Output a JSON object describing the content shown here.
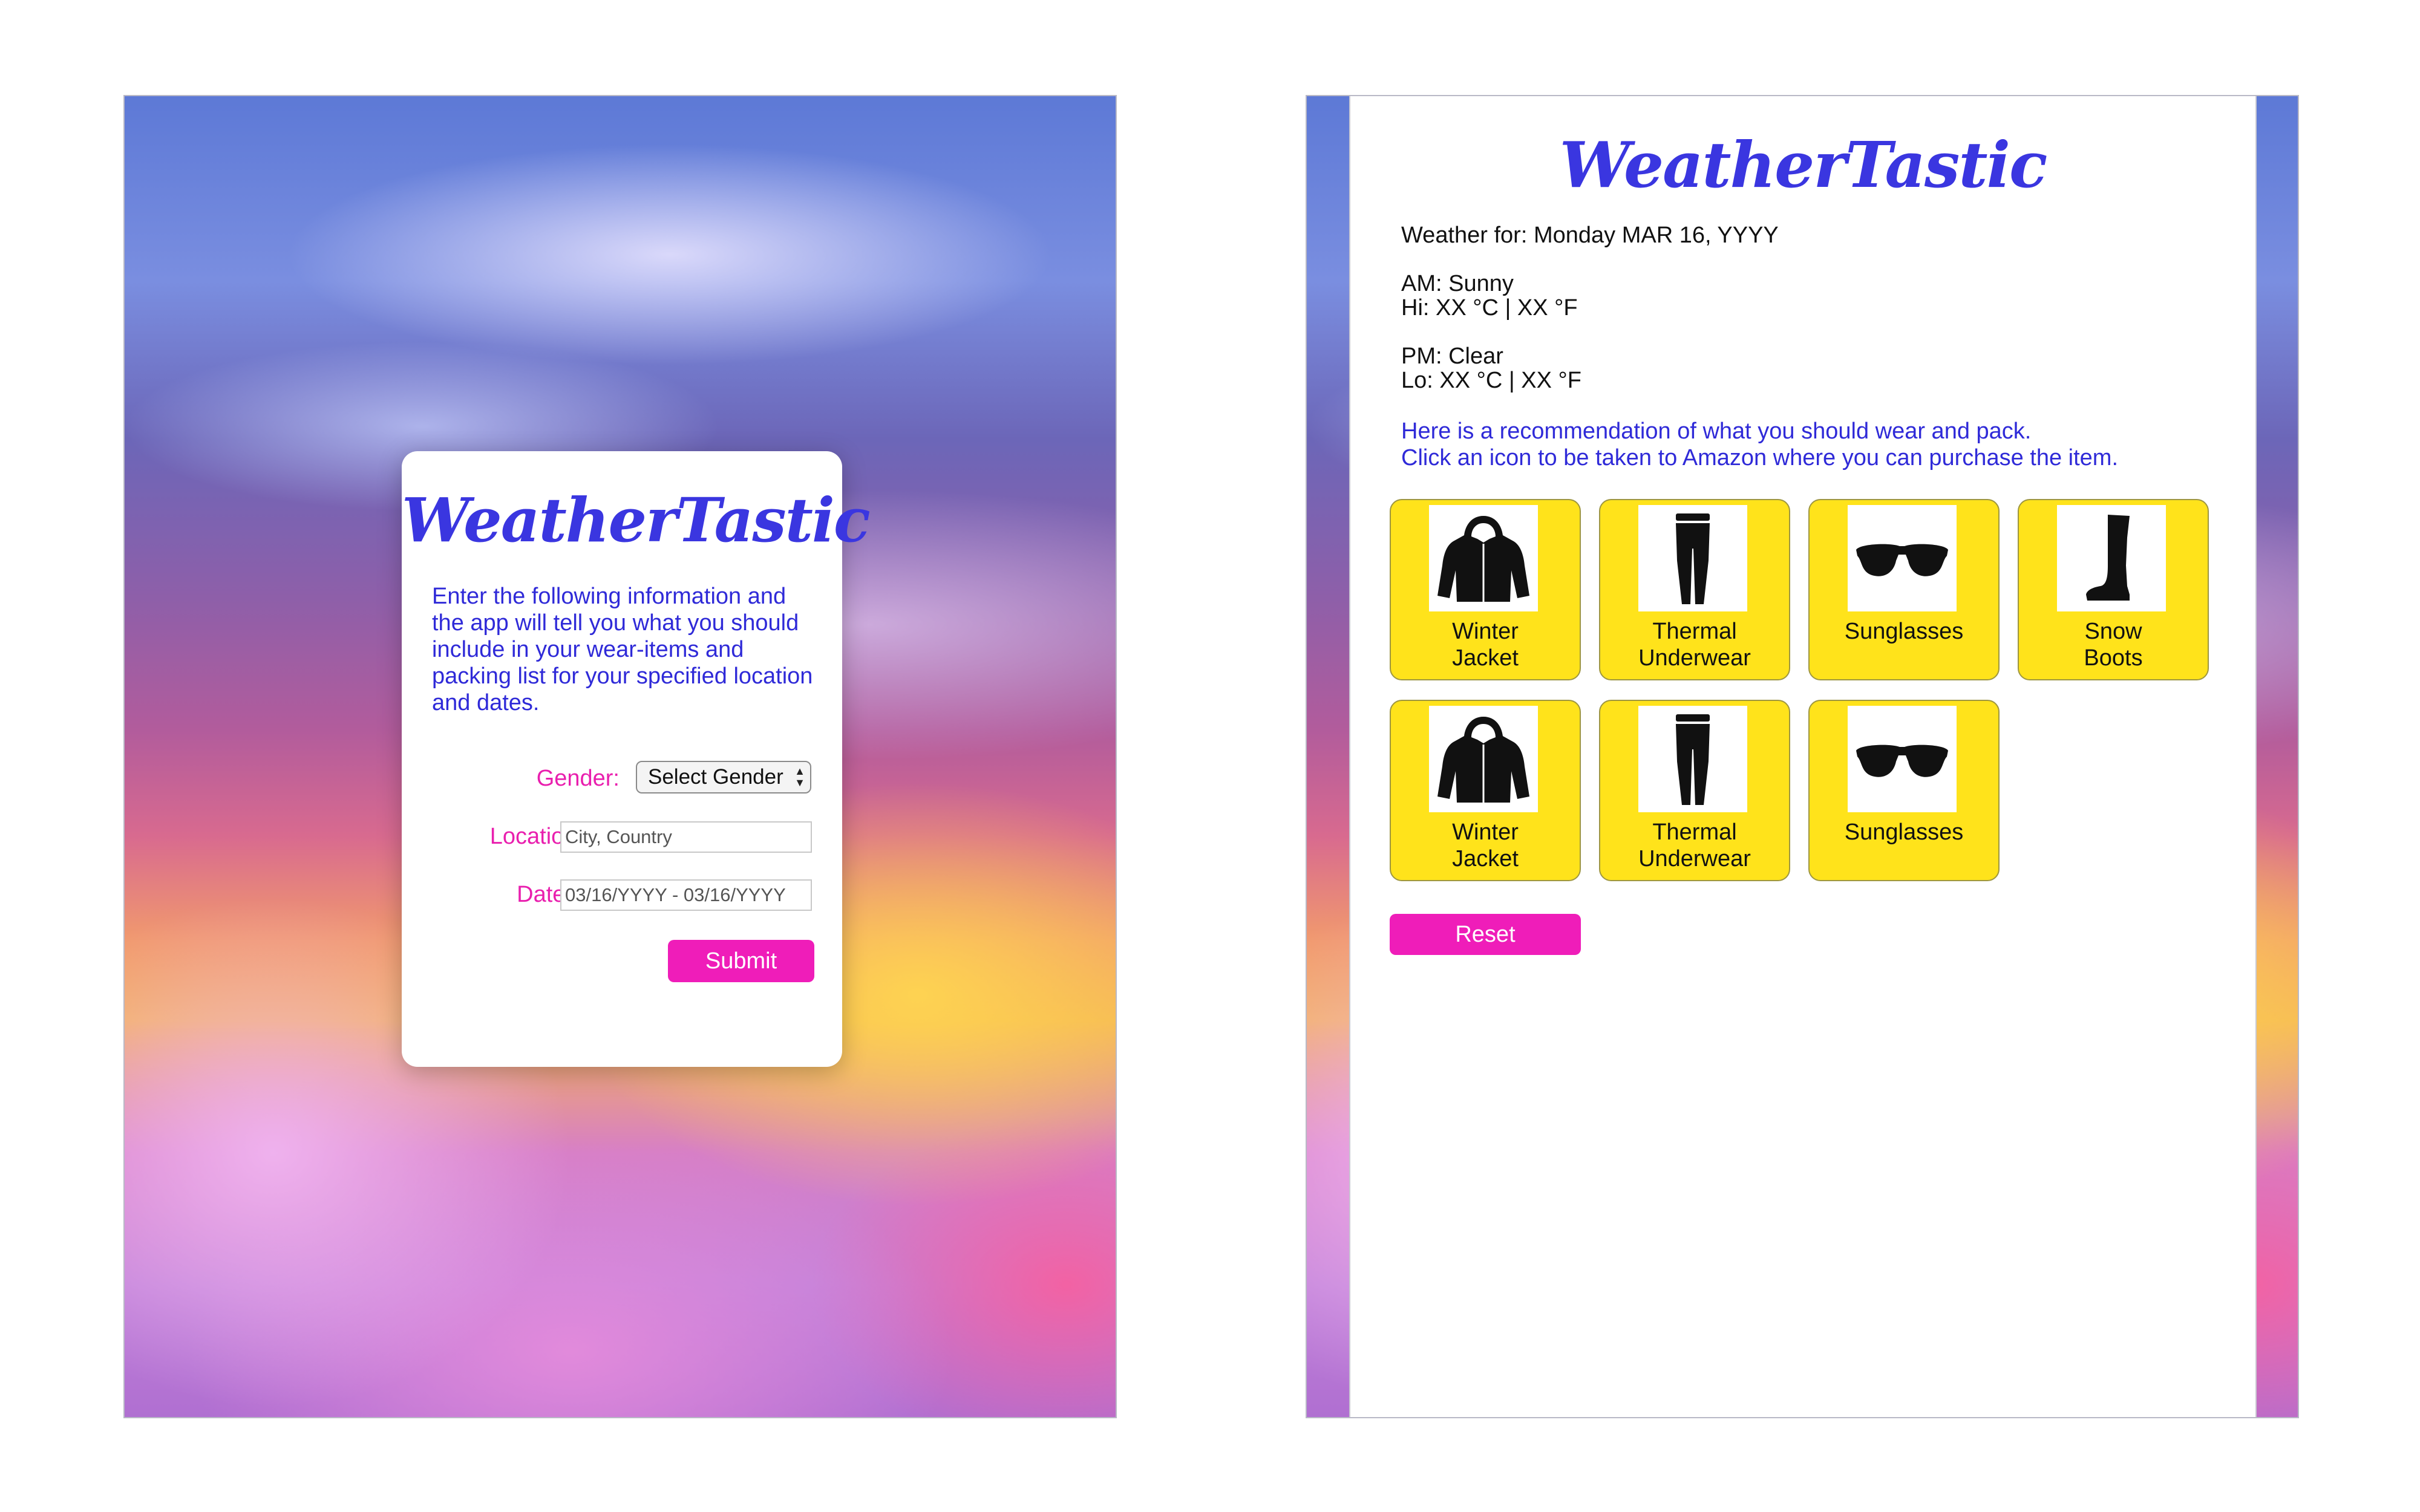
{
  "brand": {
    "name": "WeatherTastic",
    "primary_color": "#3a36e0",
    "accent_color": "#ef1db9",
    "tile_color": "#ffe31b"
  },
  "login": {
    "title": "WeatherTastic",
    "intro": "Enter the following information and the app will tell you what you should include in your wear-items and packing list for your specified location and dates.",
    "gender_label": "Gender:",
    "gender_value": "Select Gender",
    "location_label": "Location:",
    "location_placeholder": "City, Country",
    "dates_label": "Dates:",
    "dates_value": "03/16/YYYY - 03/16/YYYY",
    "submit_label": "Submit"
  },
  "results": {
    "title": "WeatherTastic",
    "weather_for": "Weather for: Monday MAR 16, YYYY",
    "am": "AM: Sunny",
    "hi": "Hi: XX °C | XX °F",
    "pm": "PM: Clear",
    "lo": "Lo: XX °C | XX °F",
    "recommendation_line1": "Here is a recommendation of what you should wear and pack.",
    "recommendation_line2": "Click an icon to be taken to Amazon where you can purchase the item.",
    "items": [
      {
        "label_line1": "Winter",
        "label_line2": "Jacket",
        "icon": "winter-jacket-icon"
      },
      {
        "label_line1": "Thermal",
        "label_line2": "Underwear",
        "icon": "thermal-underwear-icon"
      },
      {
        "label_line1": "Sunglasses",
        "label_line2": "",
        "icon": "sunglasses-icon"
      },
      {
        "label_line1": "Snow",
        "label_line2": "Boots",
        "icon": "snow-boots-icon"
      },
      {
        "label_line1": "Winter",
        "label_line2": "Jacket",
        "icon": "winter-jacket-icon"
      },
      {
        "label_line1": "Thermal",
        "label_line2": "Underwear",
        "icon": "thermal-underwear-icon"
      },
      {
        "label_line1": "Sunglasses",
        "label_line2": "",
        "icon": "sunglasses-icon"
      }
    ],
    "reset_label": "Reset"
  }
}
